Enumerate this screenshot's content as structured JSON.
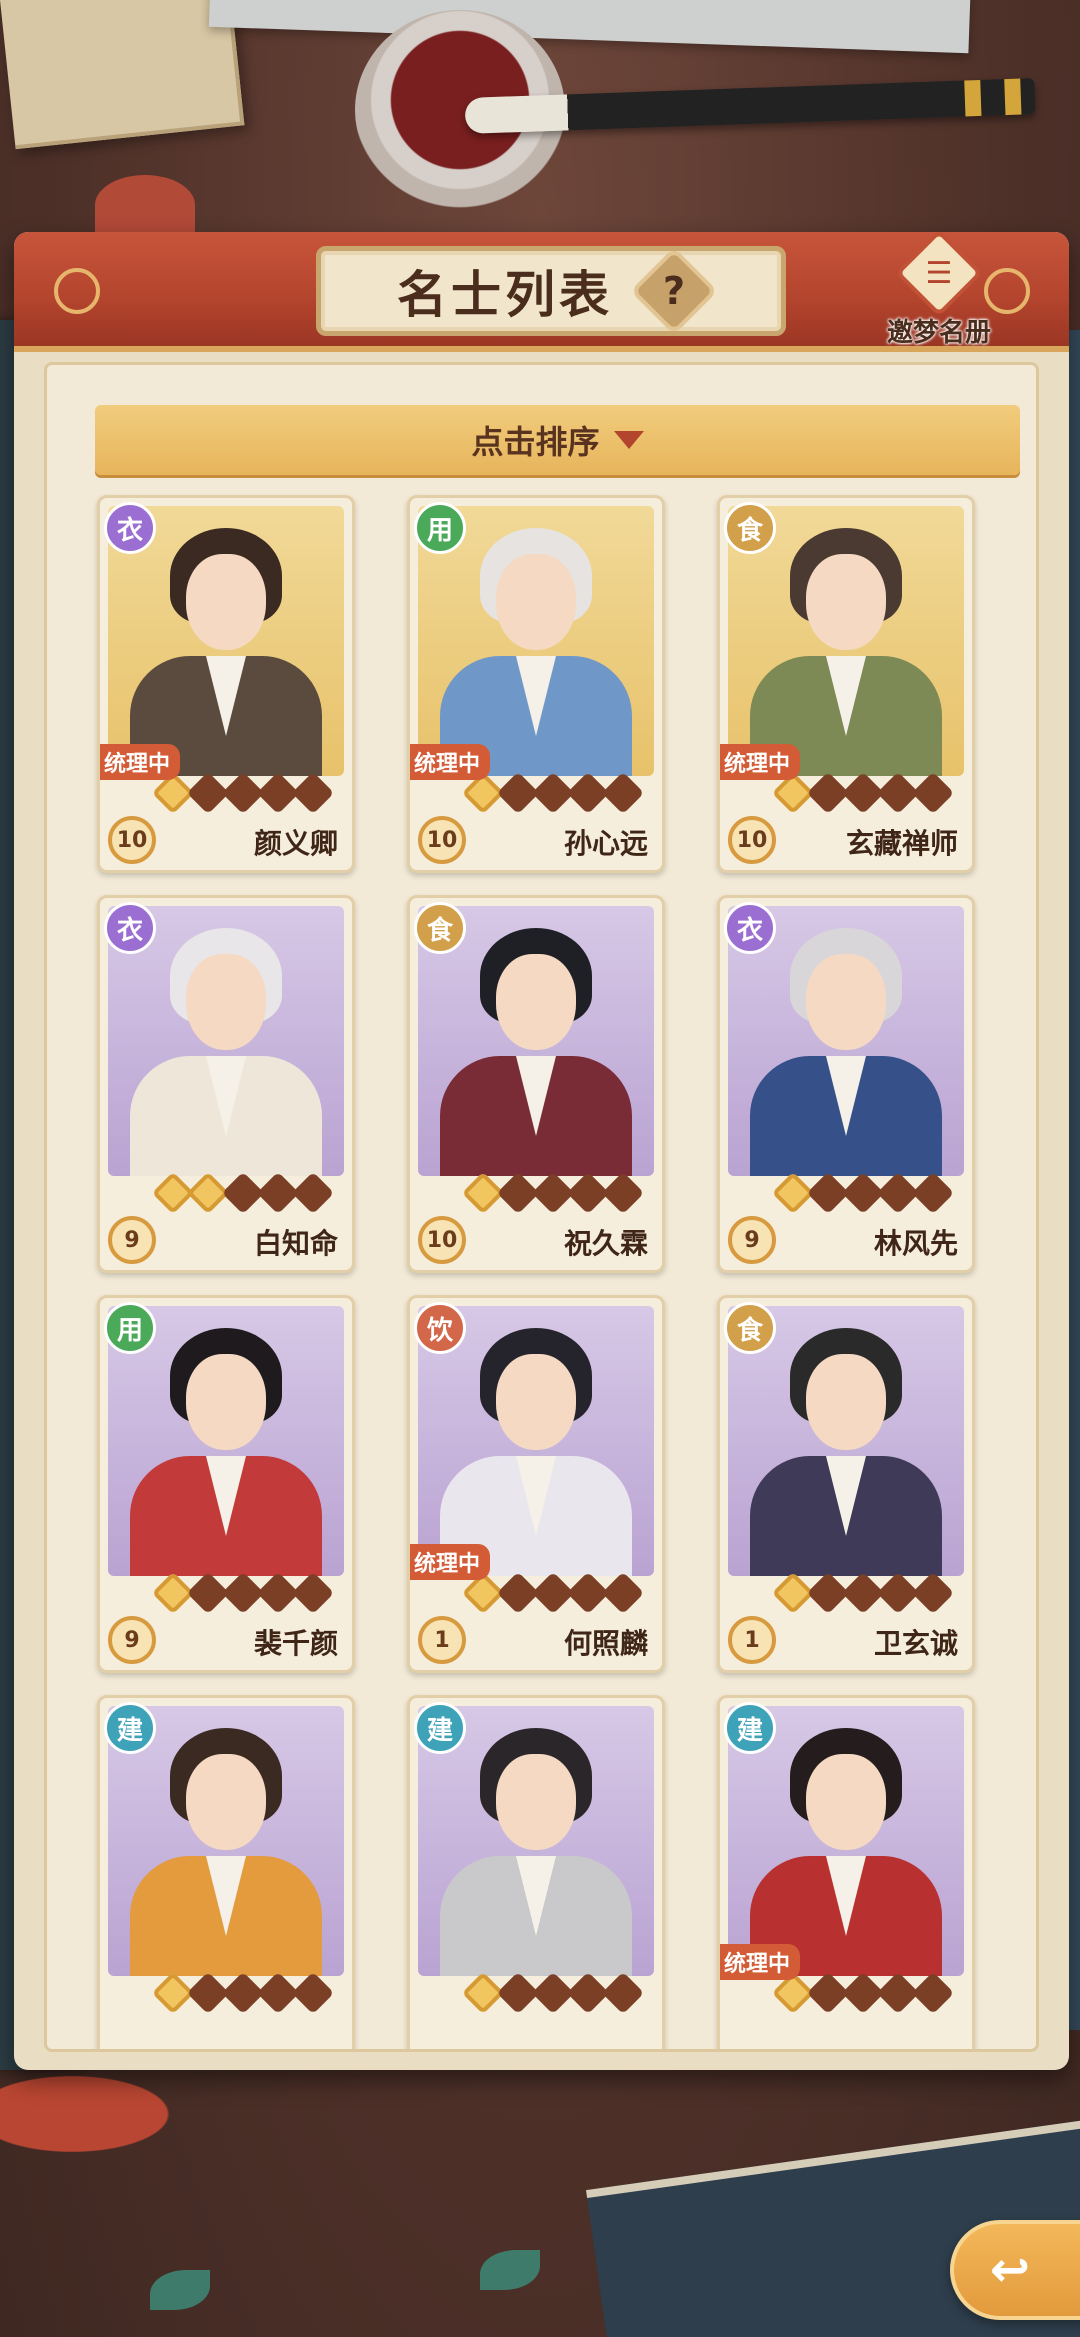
{
  "header": {
    "title": "名士列表",
    "help_icon": "question-mark",
    "register_label": "邀梦名册",
    "register_icon": "book-icon"
  },
  "sort": {
    "label": "点击排序",
    "icon": "triangle-down"
  },
  "colors": {
    "header_red": "#b3442d",
    "sort_gold": "#e7b55b",
    "status_orange": "#d35c36",
    "badge_yi": "#9b6fd1",
    "badge_yong": "#4aaa59",
    "badge_shi": "#d2a04a",
    "badge_yin": "#d2674a",
    "badge_jian": "#3ea3b8"
  },
  "cards": [
    {
      "type": "衣",
      "name": "颜义卿",
      "level": "10",
      "stars_on": 1,
      "status": "统理中",
      "bg": "gold"
    },
    {
      "type": "用",
      "name": "孙心远",
      "level": "10",
      "stars_on": 1,
      "status": "统理中",
      "bg": "gold"
    },
    {
      "type": "食",
      "name": "玄藏禅师",
      "level": "10",
      "stars_on": 1,
      "status": "统理中",
      "bg": "gold"
    },
    {
      "type": "衣",
      "name": "白知命",
      "level": "9",
      "stars_on": 2,
      "status": "",
      "bg": "purple"
    },
    {
      "type": "食",
      "name": "祝久霖",
      "level": "10",
      "stars_on": 1,
      "status": "",
      "bg": "purple"
    },
    {
      "type": "衣",
      "name": "林风先",
      "level": "9",
      "stars_on": 1,
      "status": "",
      "bg": "purple"
    },
    {
      "type": "用",
      "name": "裴千颜",
      "level": "9",
      "stars_on": 1,
      "status": "",
      "bg": "purple"
    },
    {
      "type": "饮",
      "name": "何照麟",
      "level": "1",
      "stars_on": 1,
      "status": "统理中",
      "bg": "purple"
    },
    {
      "type": "食",
      "name": "卫玄诚",
      "level": "1",
      "stars_on": 1,
      "status": "",
      "bg": "purple"
    },
    {
      "type": "建",
      "name": "",
      "level": "",
      "stars_on": 1,
      "status": "",
      "bg": "purple"
    },
    {
      "type": "建",
      "name": "",
      "level": "",
      "stars_on": 1,
      "status": "",
      "bg": "purple"
    },
    {
      "type": "建",
      "name": "",
      "level": "",
      "stars_on": 1,
      "status": "统理中",
      "bg": "purple"
    }
  ],
  "back_button": {
    "icon": "return-arrow-icon"
  }
}
